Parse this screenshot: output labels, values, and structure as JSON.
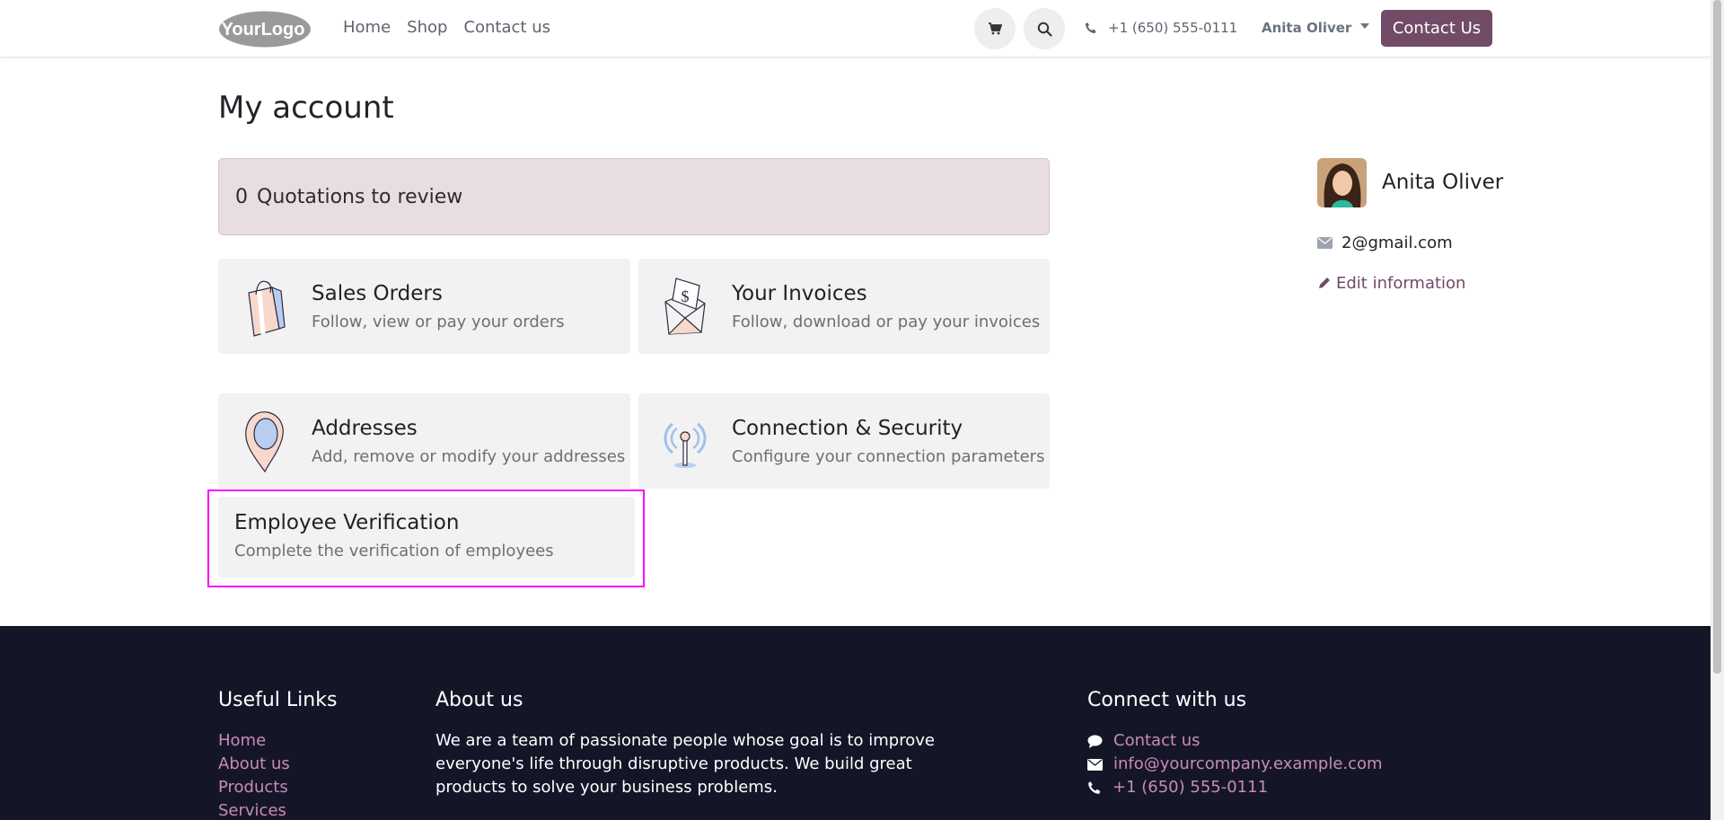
{
  "header": {
    "logo_text": "YourLogo",
    "nav": [
      "Home",
      "Shop",
      "Contact us"
    ],
    "phone": "+1 (650) 555-0111",
    "user": "Anita Oliver",
    "contact_button": "Contact Us"
  },
  "main": {
    "title": "My account",
    "quotations": {
      "count": "0",
      "label": "Quotations to review"
    },
    "cards": [
      {
        "title": "Sales Orders",
        "subtitle": "Follow, view or pay your orders",
        "icon": "shopping-bag-icon"
      },
      {
        "title": "Your Invoices",
        "subtitle": "Follow, download or pay your invoices",
        "icon": "invoice-envelope-icon"
      },
      {
        "title": "Addresses",
        "subtitle": "Add, remove or modify your addresses",
        "icon": "map-pin-icon"
      },
      {
        "title": "Connection & Security",
        "subtitle": "Configure your connection parameters",
        "icon": "antenna-icon"
      }
    ],
    "employee_card": {
      "title": "Employee Verification",
      "subtitle": "Complete the verification of employees"
    }
  },
  "profile": {
    "name": "Anita Oliver",
    "email": "2@gmail.com",
    "edit_label": "Edit information"
  },
  "footer": {
    "useful_links_title": "Useful Links",
    "useful_links": [
      "Home",
      "About us",
      "Products",
      "Services"
    ],
    "about_title": "About us",
    "about_text": "We are a team of passionate people whose goal is to improve everyone's life through disruptive products. We build great products to solve your business problems.",
    "connect_title": "Connect with us",
    "connect_items": [
      {
        "label": "Contact us",
        "icon": "chat-icon"
      },
      {
        "label": "info@yourcompany.example.com",
        "icon": "envelope-icon"
      },
      {
        "label": "+1 (650) 555-0111",
        "icon": "phone-icon"
      }
    ]
  },
  "colors": {
    "brand": "#714b67",
    "footer_bg": "#141628",
    "footer_link": "#c98bb6",
    "highlight": "#ff00ff"
  }
}
